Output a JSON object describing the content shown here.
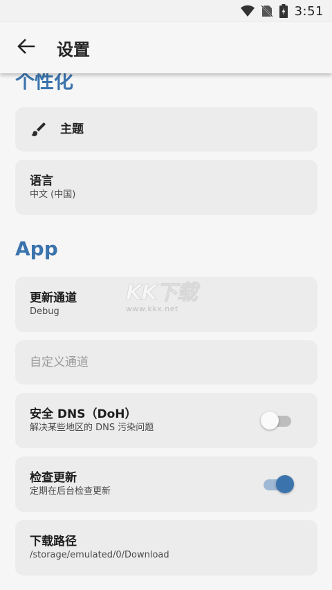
{
  "status_bar": {
    "time": "3:51"
  },
  "app_bar": {
    "title": "设置",
    "back_icon": "arrow-left-icon"
  },
  "sections": {
    "personalization": {
      "title": "个性化",
      "theme": {
        "title": "主题",
        "icon": "paintbrush-icon"
      },
      "language": {
        "title": "语言",
        "value": "中文 (中国)"
      }
    },
    "app": {
      "title": "App",
      "update_channel": {
        "title": "更新通道",
        "value": "Debug"
      },
      "custom_channel": {
        "title": "自定义通道"
      },
      "secure_dns": {
        "title": "安全 DNS（DoH）",
        "subtitle": "解决某些地区的 DNS 污染问题",
        "enabled": false
      },
      "check_updates": {
        "title": "检查更新",
        "subtitle": "定期在后台检查更新",
        "enabled": true
      },
      "download_path": {
        "title": "下载路径",
        "value": "/storage/emulated/0/Download"
      }
    }
  },
  "watermark": {
    "main": "KK下载",
    "url": "www.kkx.net"
  },
  "colors": {
    "accent": "#3b74ad",
    "card_bg": "#ececec",
    "page_bg": "#f6f6f6"
  }
}
